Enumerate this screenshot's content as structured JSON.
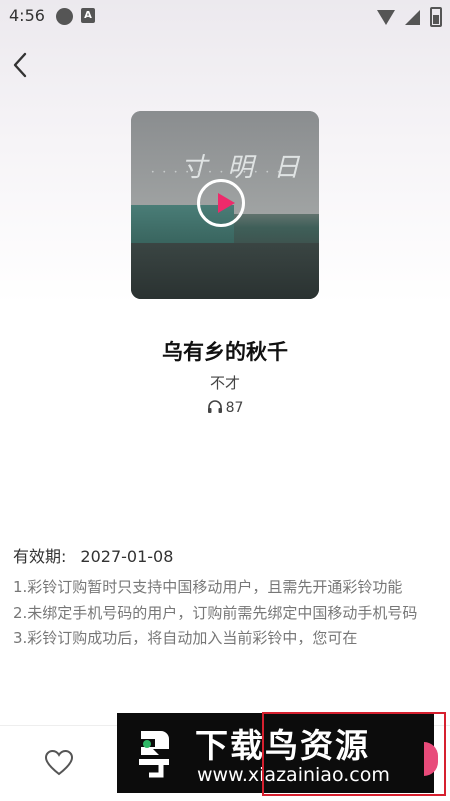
{
  "status_bar": {
    "time": "4:56",
    "left_icons": [
      "music-app-notification-icon",
      "a-app-notification-icon"
    ],
    "right_icons": [
      "wifi-icon",
      "signal-icon",
      "battery-icon"
    ]
  },
  "header": {
    "back_icon": "chevron-left-icon"
  },
  "cover": {
    "overlay_text": "寸 明 日",
    "play_icon": "play-icon",
    "accent": "#ee2a6b"
  },
  "song": {
    "title": "乌有乡的秋千",
    "artist": "不才",
    "listen_count": "87",
    "listen_icon": "headphones-icon"
  },
  "validity": {
    "label": "有效期:",
    "date": "2027-01-08"
  },
  "notes": [
    "1.彩铃订购暂时只支持中国移动用户，且需先开通彩铃功能",
    "2.未绑定手机号码的用户，订购前需先绑定中国移动手机号码",
    "3.彩铃订购成功后，将自动加入当前彩铃中，您可在"
  ],
  "bottom_bar": {
    "favorite_icon": "heart-icon"
  },
  "watermark": {
    "title": "下载鸟资源",
    "url": "www.xiazainiao.com"
  }
}
